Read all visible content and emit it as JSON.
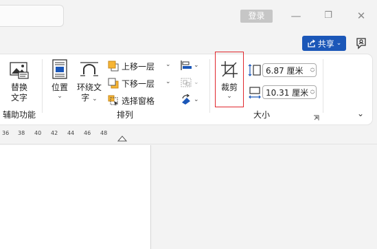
{
  "titlebar": {
    "login_label": "登录",
    "minimize_glyph": "—",
    "restore_glyph": "❐",
    "close_glyph": "✕",
    "share_label": "共享"
  },
  "ribbon": {
    "alt_text": {
      "line1": "替换",
      "line2": "文字"
    },
    "accessibility_group": "辅助功能",
    "position_label": "位置",
    "wrap_text": {
      "line1": "环绕文",
      "line2": "字"
    },
    "bring_forward_label": "上移一层",
    "send_backward_label": "下移一层",
    "selection_pane_label": "选择窗格",
    "arrange_group": "排列",
    "crop_label": "裁剪",
    "height_value": "6.87 厘米",
    "width_value": "10.31 厘米",
    "size_group": "大小"
  },
  "ruler": {
    "ticks": [
      "36",
      "38",
      "40",
      "42",
      "44",
      "46",
      "48"
    ]
  },
  "colors": {
    "accent": "#1b57b8",
    "highlight": "#e0252b",
    "ribbon_bg": "#ffffff",
    "window_bg": "#f3f3f3"
  }
}
